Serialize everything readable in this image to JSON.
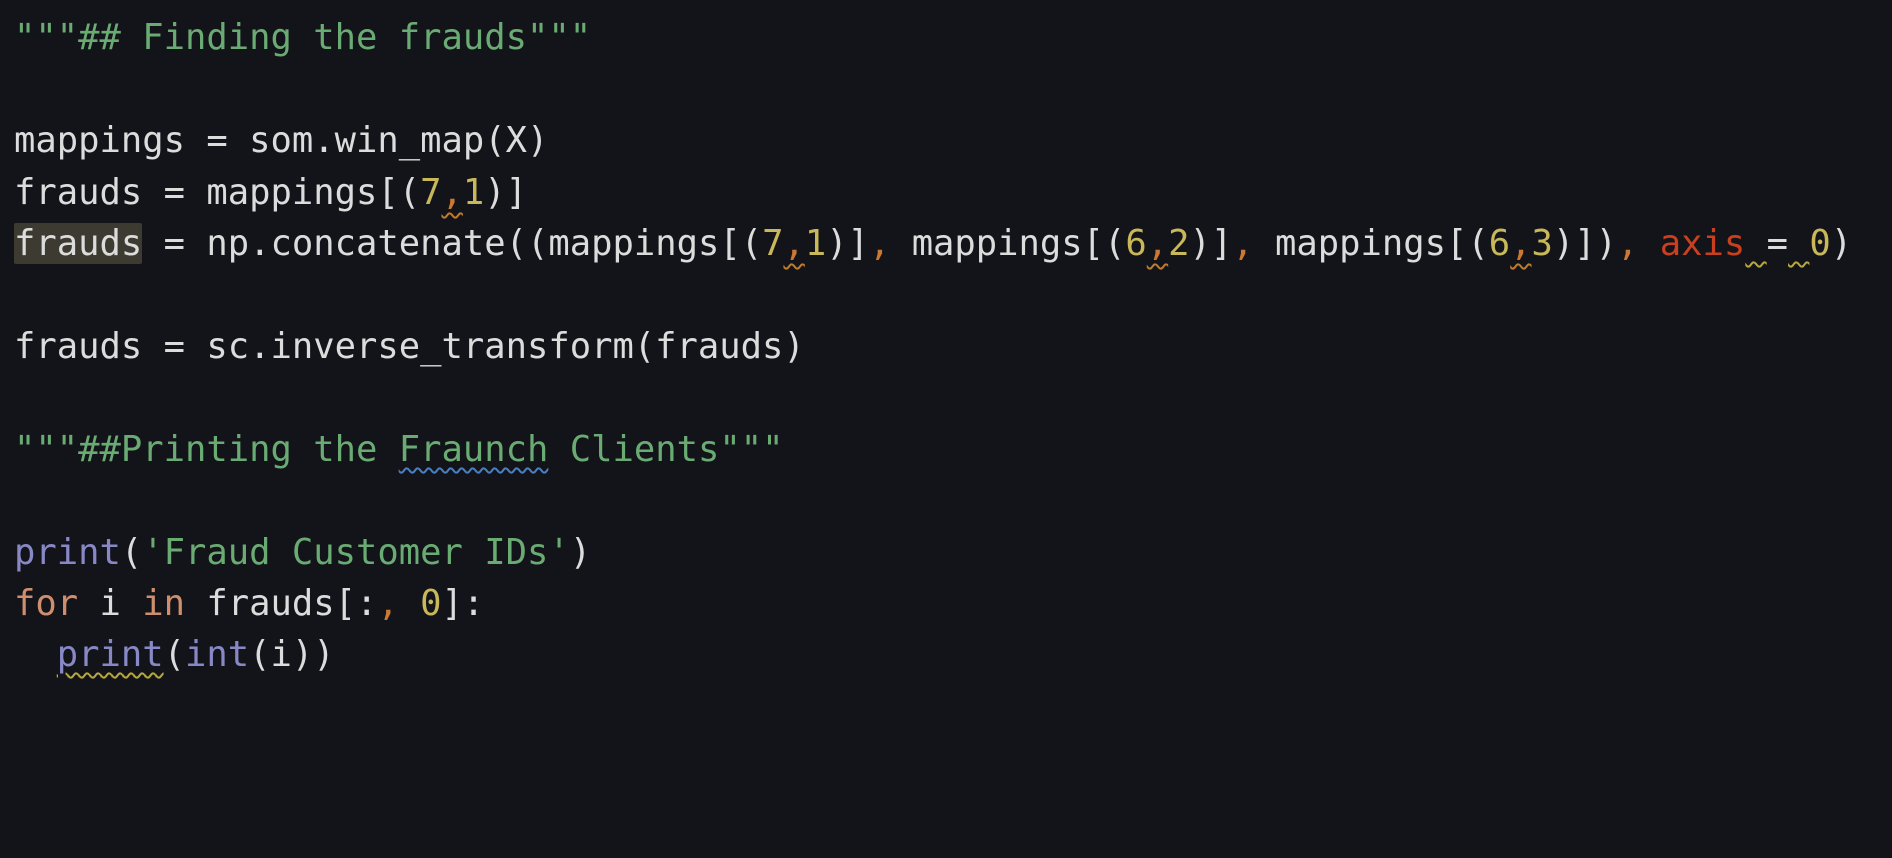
{
  "editor": {
    "background": "#131419",
    "colors": {
      "plain": "#dcdcdc",
      "docstring": "#6aab73",
      "number": "#c8b85a",
      "comma": "#cc7832",
      "keyword": "#cf8e6d",
      "builtin": "#8888c6",
      "parameter": "#c9401f",
      "highlight": "#3d3a31"
    },
    "lines": [
      {
        "tokens": [
          {
            "text": "\"\"\"## Finding the frauds\"\"\"",
            "kind": "doc"
          }
        ]
      },
      {
        "tokens": []
      },
      {
        "tokens": [
          {
            "text": "mappings = som.win_map(X)",
            "kind": "plain"
          }
        ]
      },
      {
        "tokens": [
          {
            "text": "frauds = mappings[(",
            "kind": "plain"
          },
          {
            "text": "7",
            "kind": "num"
          },
          {
            "text": ",",
            "kind": "comma",
            "mark": "weak"
          },
          {
            "text": "1",
            "kind": "num"
          },
          {
            "text": ")]",
            "kind": "plain"
          }
        ]
      },
      {
        "tokens": [
          {
            "text": "frauds",
            "kind": "plain",
            "mark": "highlight"
          },
          {
            "text": " = np.concatenate((mappings[(",
            "kind": "plain"
          },
          {
            "text": "7",
            "kind": "num"
          },
          {
            "text": ",",
            "kind": "comma",
            "mark": "weak"
          },
          {
            "text": "1",
            "kind": "num"
          },
          {
            "text": ")]",
            "kind": "plain"
          },
          {
            "text": ", ",
            "kind": "comma"
          },
          {
            "text": "mappings[(",
            "kind": "plain"
          },
          {
            "text": "6",
            "kind": "num"
          },
          {
            "text": ",",
            "kind": "comma",
            "mark": "weak"
          },
          {
            "text": "2",
            "kind": "num"
          },
          {
            "text": ")]",
            "kind": "plain"
          },
          {
            "text": ", ",
            "kind": "comma"
          },
          {
            "text": "mappings[(",
            "kind": "plain"
          },
          {
            "text": "6",
            "kind": "num"
          },
          {
            "text": ",",
            "kind": "comma",
            "mark": "weak"
          },
          {
            "text": "3",
            "kind": "num"
          },
          {
            "text": ")])",
            "kind": "plain"
          },
          {
            "text": ", ",
            "kind": "comma"
          },
          {
            "text": "axis",
            "kind": "param"
          },
          {
            "text": " ",
            "kind": "plain",
            "mark": "warn"
          },
          {
            "text": "=",
            "kind": "plain"
          },
          {
            "text": " ",
            "kind": "plain",
            "mark": "warn"
          },
          {
            "text": "0",
            "kind": "num"
          },
          {
            "text": ")",
            "kind": "plain"
          }
        ]
      },
      {
        "tokens": []
      },
      {
        "tokens": [
          {
            "text": "frauds = sc.inverse_transform(frauds)",
            "kind": "plain"
          }
        ]
      },
      {
        "tokens": []
      },
      {
        "tokens": [
          {
            "text": "\"\"\"##Printing the ",
            "kind": "doc"
          },
          {
            "text": "Fraunch",
            "kind": "doc",
            "mark": "typo"
          },
          {
            "text": " Clients\"\"\"",
            "kind": "doc"
          }
        ]
      },
      {
        "tokens": []
      },
      {
        "tokens": [
          {
            "text": "print",
            "kind": "builtin"
          },
          {
            "text": "(",
            "kind": "plain"
          },
          {
            "text": "'Fraud Customer IDs'",
            "kind": "str"
          },
          {
            "text": ")",
            "kind": "plain"
          }
        ]
      },
      {
        "tokens": [
          {
            "text": "for",
            "kind": "kw"
          },
          {
            "text": " i ",
            "kind": "plain"
          },
          {
            "text": "in",
            "kind": "kw"
          },
          {
            "text": " frauds[:",
            "kind": "plain"
          },
          {
            "text": ", ",
            "kind": "comma"
          },
          {
            "text": "0",
            "kind": "num"
          },
          {
            "text": "]:",
            "kind": "plain"
          }
        ]
      },
      {
        "tokens": [
          {
            "text": "  ",
            "kind": "plain"
          },
          {
            "text": "print",
            "kind": "builtin",
            "mark": "warn"
          },
          {
            "text": "(",
            "kind": "plain"
          },
          {
            "text": "int",
            "kind": "builtin"
          },
          {
            "text": "(i))",
            "kind": "plain"
          }
        ]
      }
    ]
  }
}
